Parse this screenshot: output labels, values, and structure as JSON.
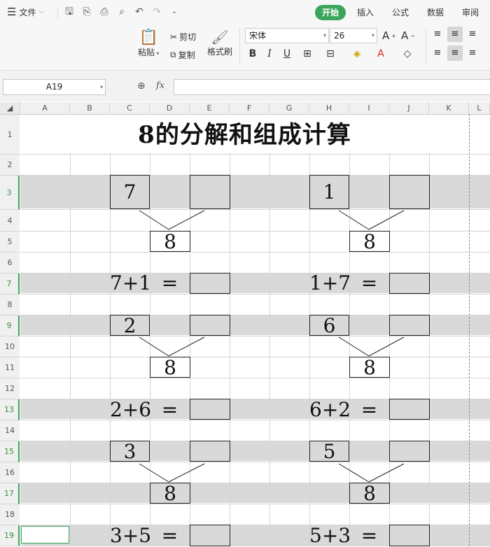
{
  "menu": {
    "file_label": "文件",
    "tabs": [
      "开始",
      "插入",
      "公式",
      "数据",
      "审阅"
    ],
    "active_tab": "开始"
  },
  "ribbon": {
    "paste_label": "粘贴",
    "cut_label": "剪切",
    "copy_label": "复制",
    "format_painter_label": "格式刷",
    "font_name": "宋体",
    "font_size": "26",
    "bold": "B",
    "italic": "I",
    "underline": "U"
  },
  "formula_bar": {
    "name_box": "A19",
    "fx_label": "fx",
    "formula_value": ""
  },
  "columns": [
    "A",
    "B",
    "C",
    "D",
    "E",
    "F",
    "G",
    "H",
    "I",
    "J",
    "K",
    "L"
  ],
  "rows": [
    "1",
    "2",
    "3",
    "4",
    "5",
    "6",
    "7",
    "8",
    "9",
    "10",
    "11",
    "12",
    "13",
    "14",
    "15",
    "16",
    "17",
    "18",
    "19"
  ],
  "sheet": {
    "title": "8的分解和组成计算",
    "blocks": [
      {
        "left_part": "7",
        "whole": "8",
        "equation_left": "7+1",
        "equals": "="
      },
      {
        "left_part": "1",
        "whole": "8",
        "equation_left": "1+7",
        "equals": "="
      },
      {
        "left_part": "2",
        "whole": "8",
        "equation_left": "2+6",
        "equals": "="
      },
      {
        "left_part": "6",
        "whole": "8",
        "equation_left": "6+2",
        "equals": "="
      },
      {
        "left_part": "3",
        "whole": "8",
        "equation_left": "3+5",
        "equals": "="
      },
      {
        "left_part": "5",
        "whole": "8",
        "equation_left": "5+3",
        "equals": "="
      }
    ]
  },
  "colors": {
    "accent": "#3aa55c",
    "band": "#d9d9d9"
  }
}
